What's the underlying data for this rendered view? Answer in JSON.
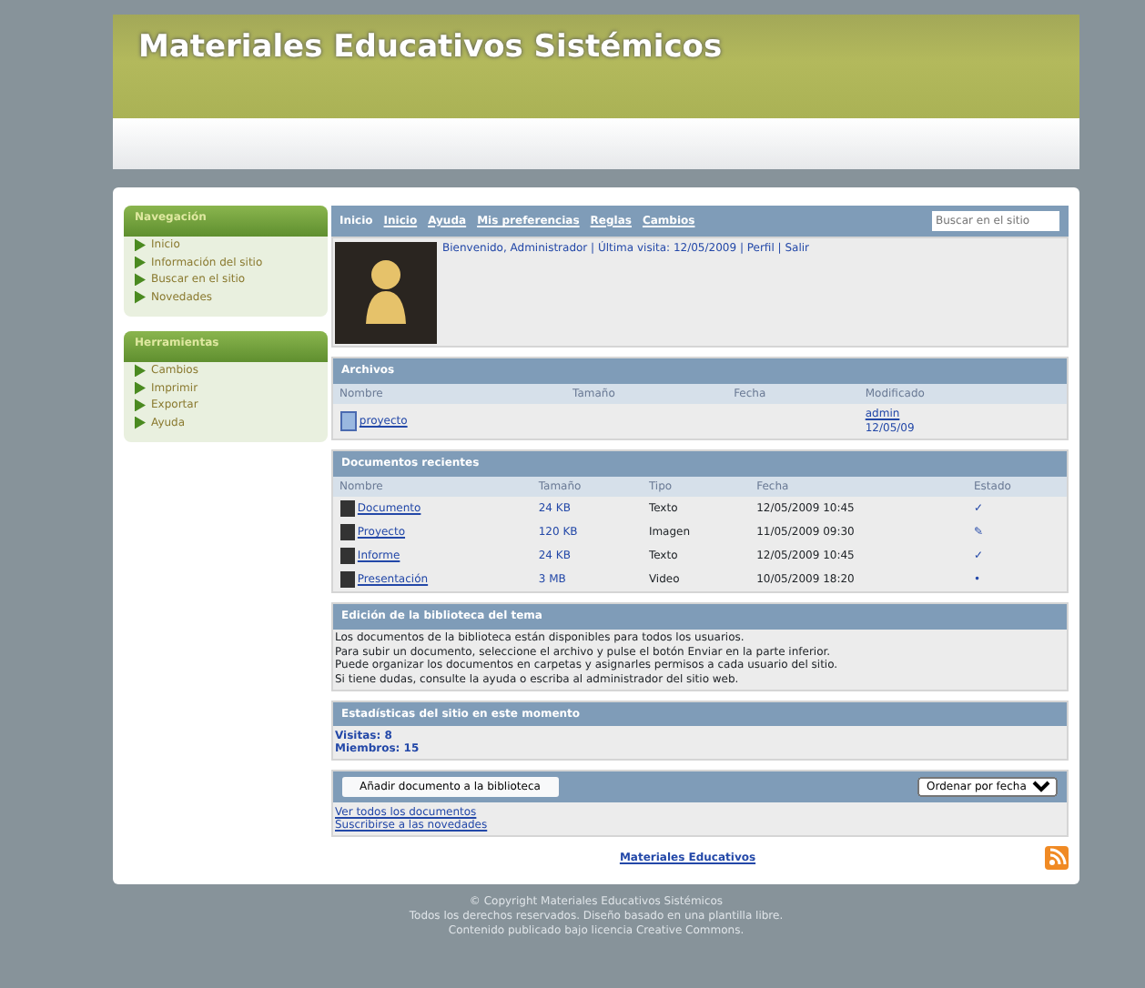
{
  "site_title": "Materiales Educativos Sistémicos",
  "sidebar": [
    {
      "title": "Navegación",
      "items": [
        "Inicio",
        "Información del sitio",
        "Buscar en el sitio",
        "Novedades"
      ]
    },
    {
      "title": "Herramientas",
      "items": [
        "Cambios",
        "Imprimir",
        "Exportar",
        "Ayuda"
      ]
    }
  ],
  "topbar": {
    "title": "Inicio",
    "links": [
      "Inicio",
      "Ayuda",
      "Mis preferencias",
      "Reglas",
      "Cambios"
    ],
    "search_placeholder": "Buscar en el sitio"
  },
  "user": {
    "line": "Bienvenido, Administrador | Última visita: 12/05/2009 | Perfil | Salir"
  },
  "files": {
    "title": "Archivos",
    "columns": [
      "Nombre",
      "Tamaño",
      "Fecha",
      "Modificado"
    ],
    "rows": [
      {
        "name": "proyecto",
        "modified_by": "admin",
        "modified_date": "12/05/09"
      }
    ]
  },
  "recent": {
    "title": "Documentos recientes",
    "columns": [
      "Nombre",
      "Tamaño",
      "Tipo",
      "Fecha",
      "Estado"
    ],
    "rows": [
      {
        "name": "Documento",
        "size": "24 KB",
        "type": "Texto",
        "date": "12/05/2009 10:45",
        "status": "✓"
      },
      {
        "name": "Proyecto",
        "size": "120 KB",
        "type": "Imagen",
        "date": "11/05/2009 09:30",
        "status": "✎"
      },
      {
        "name": "Informe",
        "size": "24 KB",
        "type": "Texto",
        "date": "12/05/2009 10:45",
        "status": "✓"
      },
      {
        "name": "Presentación",
        "size": "3 MB",
        "type": "Video",
        "date": "10/05/2009 18:20",
        "status": "•"
      }
    ]
  },
  "edit": {
    "title": "Edición de la biblioteca del tema",
    "lines": [
      "Los documentos de la biblioteca están disponibles para todos los usuarios.",
      "Para subir un documento, seleccione el archivo y pulse el botón Enviar en la parte inferior.",
      "Puede organizar los documentos en carpetas y asignarles permisos a cada usuario del sitio.",
      "Si tiene dudas, consulte la ayuda o escriba al administrador del sitio web."
    ]
  },
  "stats": {
    "title": "Estadísticas del sitio en este momento",
    "lines": [
      "Visitas: 8",
      "Miembros: 15"
    ]
  },
  "toolbar": {
    "button": "Añadir documento a la biblioteca",
    "select": "Ordenar por fecha"
  },
  "bottom_links": [
    "Ver todos los documentos",
    "Suscribirse a las novedades"
  ],
  "center_link": "Materiales Educativos",
  "footer": [
    "© Copyright Materiales Educativos Sistémicos",
    "Todos los derechos reservados. Diseño basado en una plantilla libre.",
    "Contenido publicado bajo licencia Creative Commons."
  ]
}
